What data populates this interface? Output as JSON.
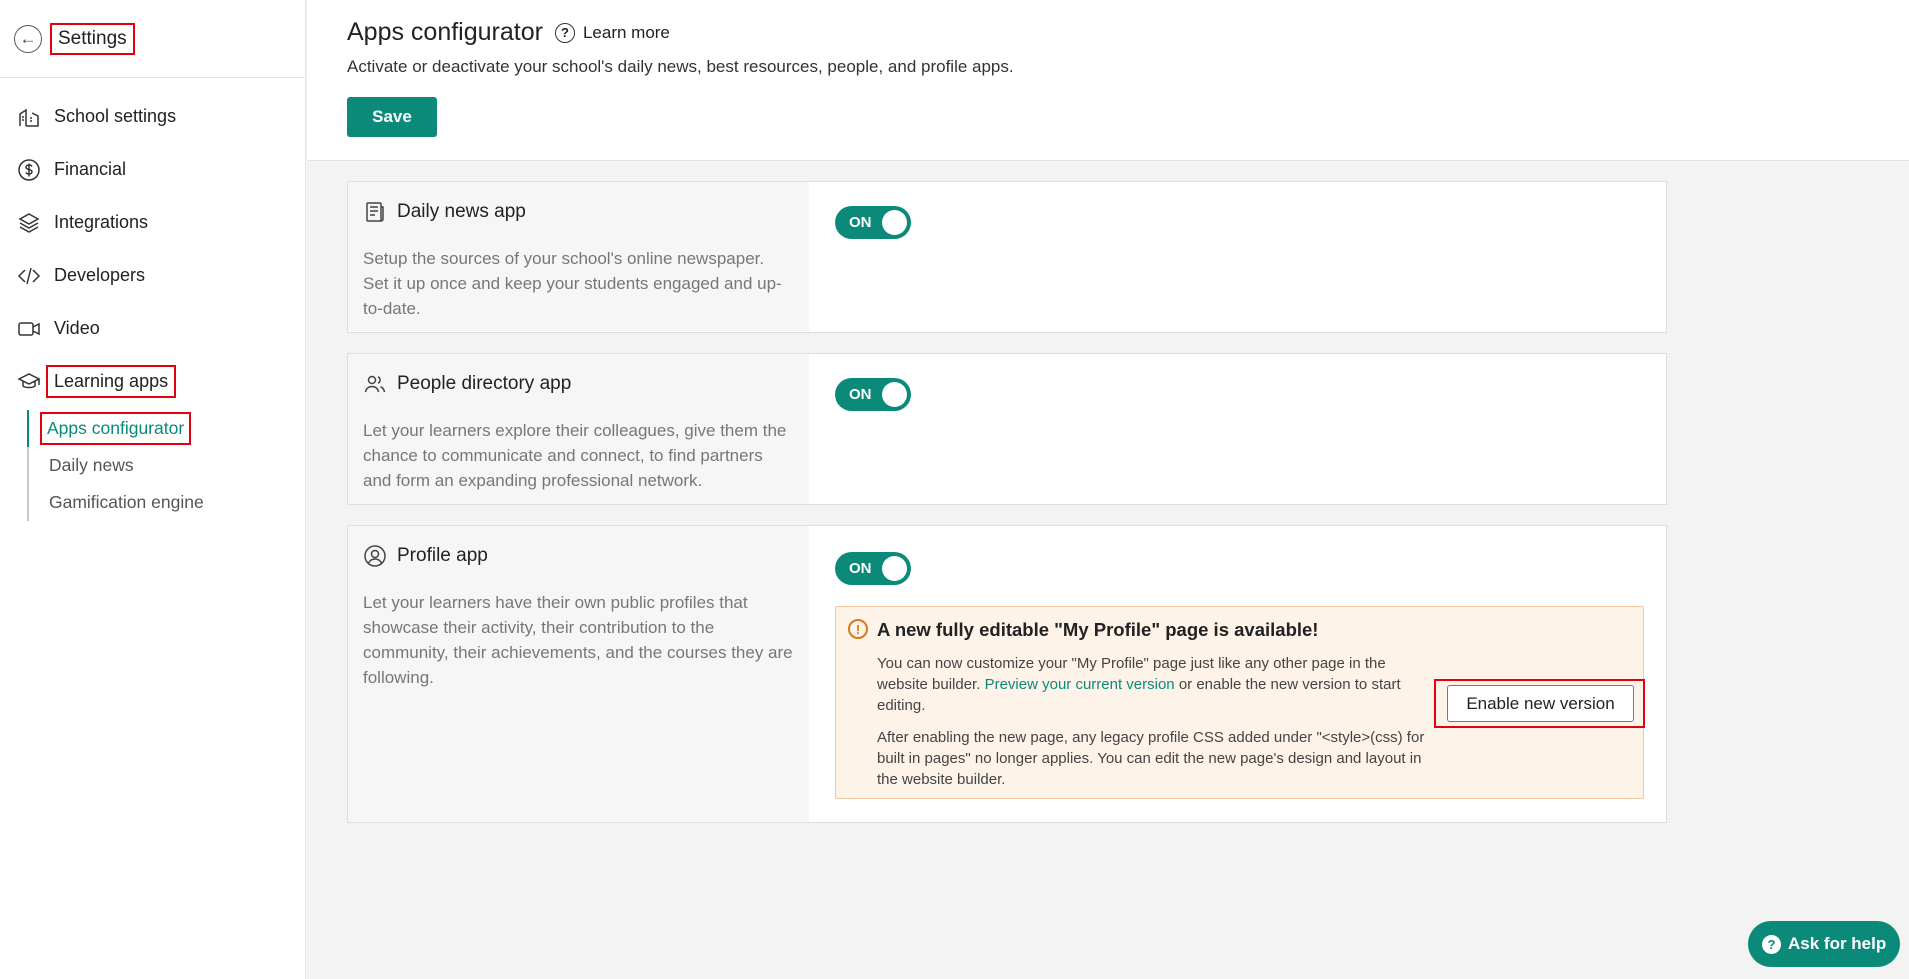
{
  "sidebar": {
    "title": "Settings",
    "items": [
      {
        "label": "School settings",
        "icon": "school-icon"
      },
      {
        "label": "Financial",
        "icon": "dollar-icon"
      },
      {
        "label": "Integrations",
        "icon": "layers-icon"
      },
      {
        "label": "Developers",
        "icon": "code-icon"
      },
      {
        "label": "Video",
        "icon": "video-icon"
      },
      {
        "label": "Learning apps",
        "icon": "graduation-cap-icon"
      }
    ],
    "sub_items": [
      "Apps configurator",
      "Daily news",
      "Gamification engine"
    ]
  },
  "header": {
    "title": "Apps configurator",
    "learn_more": "Learn more",
    "subtitle": "Activate or deactivate your school's daily news, best resources, people, and profile apps.",
    "save_label": "Save"
  },
  "cards": [
    {
      "title": "Daily news app",
      "description": "Setup the sources of your school's online newspaper. Set it up once and keep your students engaged and up-to-date.",
      "toggle": "ON"
    },
    {
      "title": "People directory app",
      "description": "Let your learners explore their colleagues, give them the chance to communicate and connect, to find partners and form an expanding professional network.",
      "toggle": "ON"
    },
    {
      "title": "Profile app",
      "description": "Let your learners have their own public profiles that showcase their activity, their contribution to the community, their achievements, and the courses they are following.",
      "toggle": "ON"
    }
  ],
  "notice": {
    "title": "A new fully editable \"My Profile\" page is available!",
    "p1_before": "You can now customize your \"My Profile\" page just like any other page in the website builder. ",
    "p1_link": "Preview your current version",
    "p1_after": " or enable the new version to start editing.",
    "p2": "After enabling the new page, any legacy profile CSS added under \"<style>(css) for built in pages\" no longer applies. You can edit the new page's design and layout in the website builder.",
    "button": "Enable new version"
  },
  "ask_help": "Ask for help",
  "colors": {
    "accent": "#0b8a7a",
    "highlight": "#e3000f",
    "notice_bg": "#fdf3e9"
  }
}
